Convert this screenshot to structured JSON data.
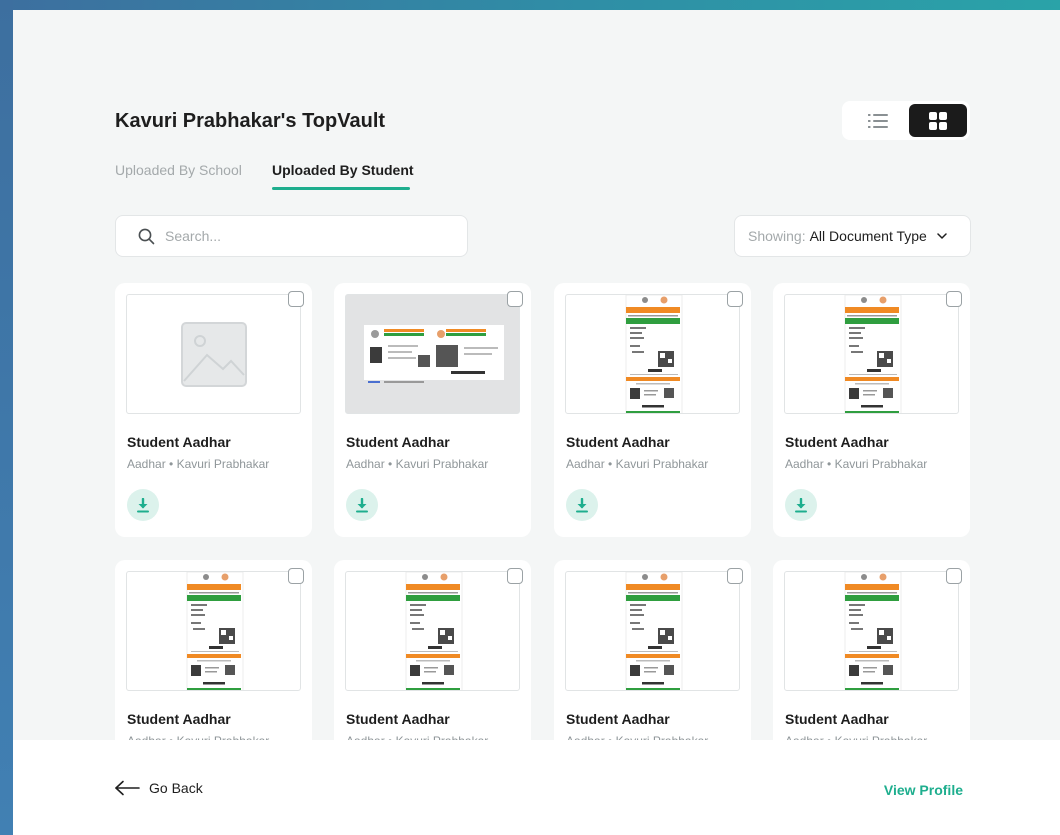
{
  "page": {
    "title": "Kavuri Prabhakar's TopVault"
  },
  "view_toggle": {
    "active": "grid",
    "options": [
      "list",
      "grid"
    ]
  },
  "tabs": [
    {
      "label": "Uploaded By School",
      "active": false
    },
    {
      "label": "Uploaded By Student",
      "active": true
    }
  ],
  "search": {
    "placeholder": "Search...",
    "value": ""
  },
  "filter": {
    "prefix": "Showing:",
    "value": "All Document Type"
  },
  "documents": [
    {
      "title": "Student Aadhar",
      "subtitle": "Aadhar • Kavuri Prabhakar",
      "thumbnail": "image-placeholder"
    },
    {
      "title": "Student Aadhar",
      "subtitle": "Aadhar • Kavuri Prabhakar",
      "thumbnail": "aadhar-card-landscape"
    },
    {
      "title": "Student Aadhar",
      "subtitle": "Aadhar • Kavuri Prabhakar",
      "thumbnail": "aadhar-letter"
    },
    {
      "title": "Student Aadhar",
      "subtitle": "Aadhar • Kavuri Prabhakar",
      "thumbnail": "aadhar-letter"
    },
    {
      "title": "Student Aadhar",
      "subtitle": "Aadhar • Kavuri Prabhakar",
      "thumbnail": "aadhar-letter"
    },
    {
      "title": "Student Aadhar",
      "subtitle": "Aadhar • Kavuri Prabhakar",
      "thumbnail": "aadhar-letter"
    },
    {
      "title": "Student Aadhar",
      "subtitle": "Aadhar • Kavuri Prabhakar",
      "thumbnail": "aadhar-letter"
    },
    {
      "title": "Student Aadhar",
      "subtitle": "Aadhar • Kavuri Prabhakar",
      "thumbnail": "aadhar-letter"
    }
  ],
  "footer": {
    "back_label": "Go Back",
    "profile_label": "View Profile"
  },
  "colors": {
    "accent": "#1eae8e",
    "accent_light": "#dcf2ec",
    "dark": "#1b1b1b"
  }
}
